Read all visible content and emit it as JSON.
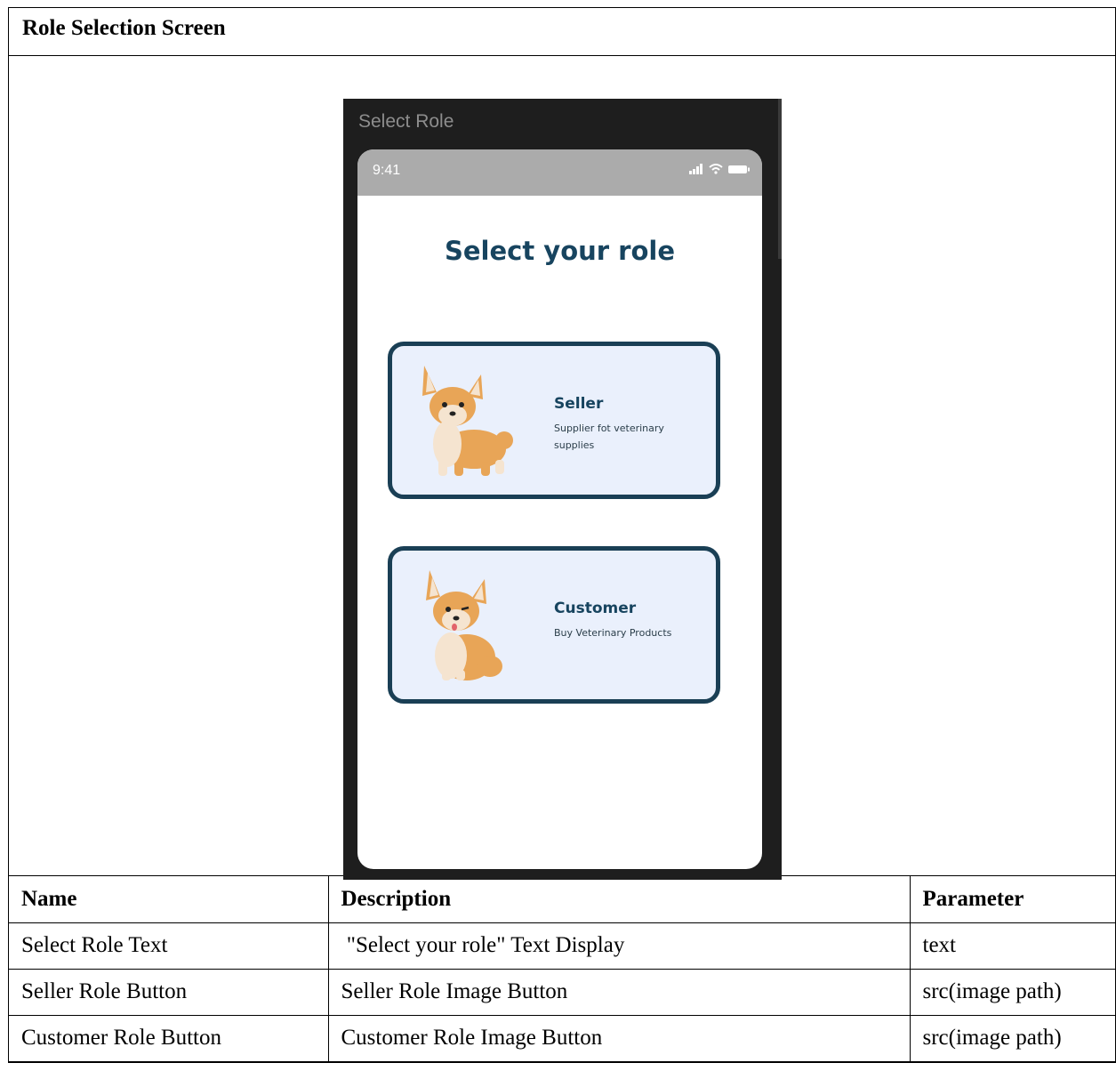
{
  "title": "Role Selection Screen",
  "mockup": {
    "window_title": "Select Role",
    "status_time": "9:41",
    "screen_title": "Select your role",
    "cards": [
      {
        "name": "Seller",
        "description": "Supplier fot veterinary supplies"
      },
      {
        "name": "Customer",
        "description": "Buy Veterinary Products"
      }
    ],
    "colors": {
      "primary": "#17445f",
      "card_bg": "#eaf0fc",
      "card_border": "#1a3f55",
      "status_bar": "#ababab",
      "frame": "#1e1e1e"
    }
  },
  "table": {
    "headers": [
      "Name",
      "Description",
      "Parameter"
    ],
    "rows": [
      [
        "Select Role Text",
        " \"Select your role\" Text Display",
        "text"
      ],
      [
        "Seller Role Button",
        "Seller Role Image Button",
        "src(image path)"
      ],
      [
        "Customer Role Button",
        "Customer Role Image Button",
        "src(image path)"
      ]
    ]
  }
}
